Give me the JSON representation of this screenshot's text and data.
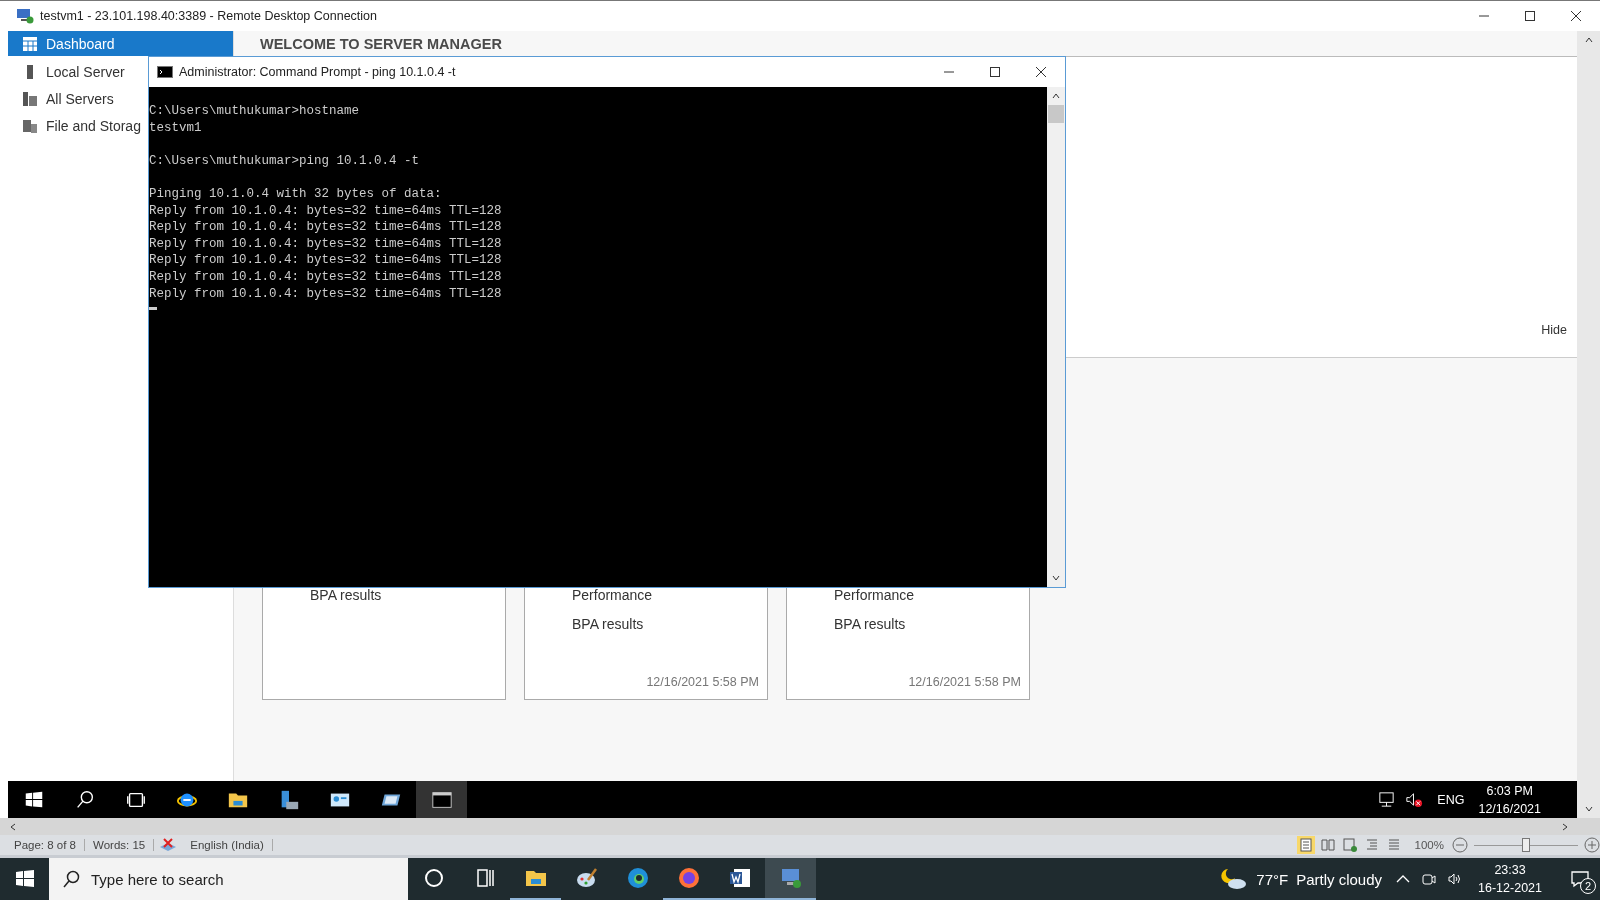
{
  "rdp_window": {
    "title": "testvm1 - 23.101.198.40:3389 - Remote Desktop Connection"
  },
  "server_manager": {
    "sidebar": {
      "items": [
        {
          "label": "Dashboard",
          "selected": true,
          "kind": "dashboard"
        },
        {
          "label": "Local Server",
          "selected": false,
          "kind": "server"
        },
        {
          "label": "All Servers",
          "selected": false,
          "kind": "servers"
        },
        {
          "label": "File and Storag",
          "selected": false,
          "kind": "storage"
        }
      ]
    },
    "header": "WELCOME TO SERVER MANAGER",
    "hide_link": "Hide",
    "cards": [
      {
        "lines": [
          "BPA results"
        ]
      },
      {
        "lines": [
          "Performance",
          "BPA results"
        ],
        "timestamp": "12/16/2021 5:58 PM"
      },
      {
        "lines": [
          "Performance",
          "BPA results"
        ],
        "timestamp": "12/16/2021 5:58 PM"
      }
    ]
  },
  "command_prompt": {
    "title": "Administrator: Command Prompt - ping  10.1.0.4 -t",
    "blocks": [
      [
        "C:\\Users\\muthukumar>hostname",
        "testvm1"
      ],
      [
        "C:\\Users\\muthukumar>ping 10.1.0.4 -t"
      ],
      [
        "Pinging 10.1.0.4 with 32 bytes of data:",
        "Reply from 10.1.0.4: bytes=32 time=64ms TTL=128",
        "Reply from 10.1.0.4: bytes=32 time=64ms TTL=128",
        "Reply from 10.1.0.4: bytes=32 time=64ms TTL=128",
        "Reply from 10.1.0.4: bytes=32 time=64ms TTL=128",
        "Reply from 10.1.0.4: bytes=32 time=64ms TTL=128",
        "Reply from 10.1.0.4: bytes=32 time=64ms TTL=128"
      ]
    ]
  },
  "remote_taskbar": {
    "items": [
      {
        "kind": "start",
        "active": false
      },
      {
        "kind": "search",
        "active": false
      },
      {
        "kind": "taskview",
        "active": false
      },
      {
        "kind": "browser",
        "active": false
      },
      {
        "kind": "folder",
        "active": false
      },
      {
        "kind": "server",
        "active": false
      },
      {
        "kind": "panel",
        "active": false
      },
      {
        "kind": "card",
        "active": false
      },
      {
        "kind": "terminal",
        "active": true
      }
    ],
    "language": "ENG",
    "time": "6:03 PM",
    "date": "12/16/2021"
  },
  "word_status": {
    "page": "Page: 8 of 8",
    "words": "Words: 15",
    "language": "English (India)",
    "zoom": "100%",
    "zoom_slider": {
      "level": 0.5
    }
  },
  "taskbar": {
    "search": {
      "placeholder": "Type here to search"
    },
    "apps": [
      {
        "kind": "cortana",
        "running": false,
        "active": false
      },
      {
        "kind": "taskview",
        "running": false,
        "active": false
      },
      {
        "kind": "folder",
        "running": true,
        "active": false
      },
      {
        "kind": "paint",
        "running": false,
        "active": false
      },
      {
        "kind": "edge",
        "running": false,
        "active": false
      },
      {
        "kind": "firefox",
        "running": true,
        "active": false
      },
      {
        "kind": "word",
        "running": true,
        "active": false
      },
      {
        "kind": "remote",
        "running": true,
        "active": true
      }
    ],
    "weather": {
      "temperature": "77°F",
      "condition": "Partly cloudy"
    },
    "time": "23:33",
    "date": "16-12-2021",
    "notifications": "2"
  }
}
